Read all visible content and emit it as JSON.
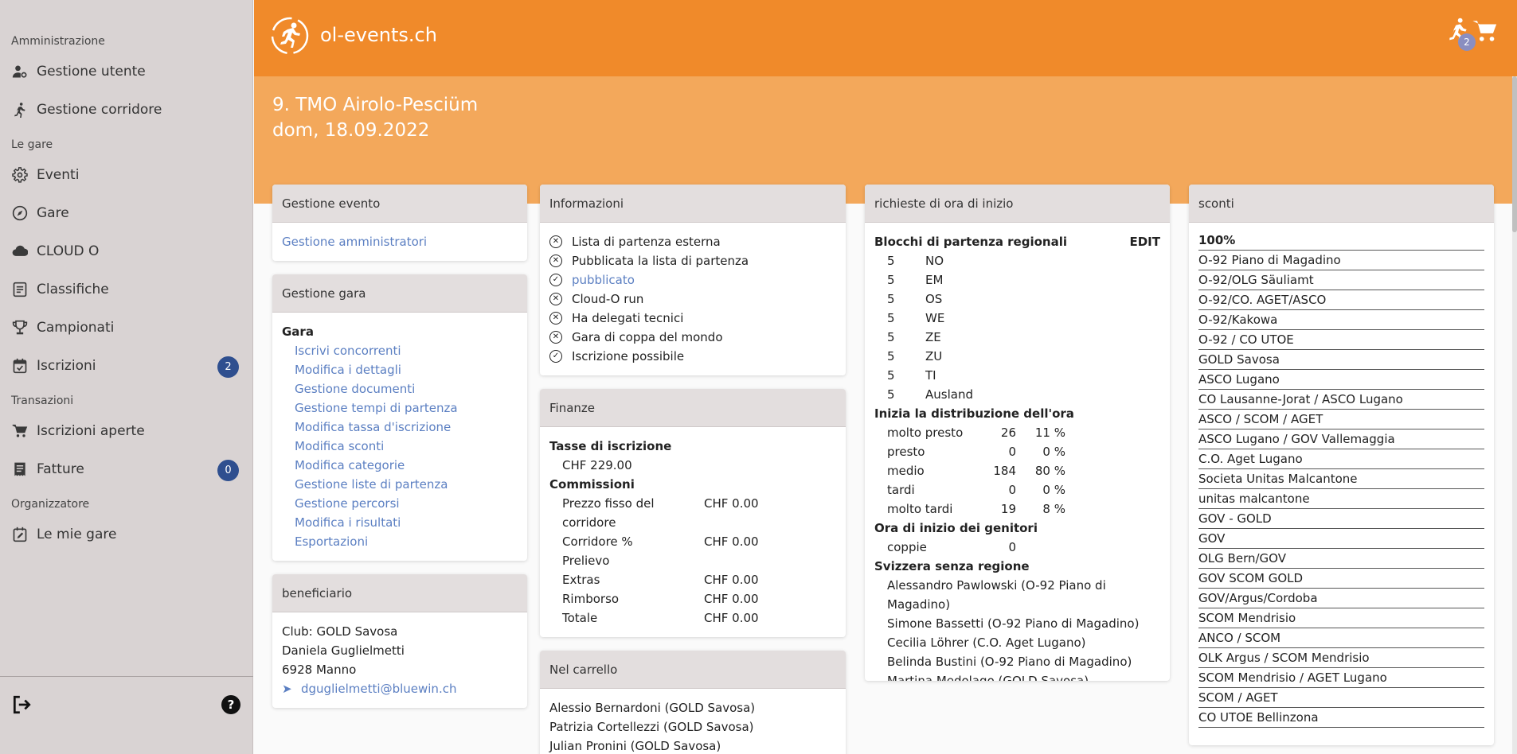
{
  "sidebar": {
    "sections": [
      {
        "title": "Amministrazione",
        "items": [
          {
            "label": "Gestione utente",
            "icon": "user-gear-icon"
          },
          {
            "label": "Gestione corridore",
            "icon": "runner-icon"
          }
        ]
      },
      {
        "title": "Le gare",
        "items": [
          {
            "label": "Eventi",
            "icon": "gear-icon"
          },
          {
            "label": "Gare",
            "icon": "compass-icon"
          },
          {
            "label": "CLOUD O",
            "icon": "cloud-icon"
          },
          {
            "label": "Classifiche",
            "icon": "list-icon"
          },
          {
            "label": "Campionati",
            "icon": "trophy-icon"
          },
          {
            "label": "Iscrizioni",
            "icon": "calendar-check-icon",
            "badge": "2"
          }
        ]
      },
      {
        "title": "Transazioni",
        "items": [
          {
            "label": "Iscrizioni aperte",
            "icon": "cart-icon"
          },
          {
            "label": "Fatture",
            "icon": "receipt-icon",
            "badge": "0"
          }
        ]
      },
      {
        "title": "Organizzatore",
        "items": [
          {
            "label": "Le mie gare",
            "icon": "calendar-edit-icon"
          }
        ]
      }
    ],
    "help_label": "?"
  },
  "header": {
    "brand": "ol-events.ch",
    "runner_badge": "2",
    "event_title": "9. TMO Airolo-Pesciüm",
    "event_date": "dom, 18.09.2022"
  },
  "gestione_evento": {
    "title": "Gestione evento",
    "link": "Gestione amministratori"
  },
  "gestione_gara": {
    "title": "Gestione gara",
    "group": "Gara",
    "links": [
      "Iscrivi concorrenti",
      "Modifica i dettagli",
      "Gestione documenti",
      "Gestione tempi di partenza",
      "Modifica tassa d'iscrizione",
      "Modifica sconti",
      "Modifica categorie",
      "Gestione liste di partenza",
      "Gestione percorsi",
      "Modifica i risultati",
      "Esportazioni"
    ]
  },
  "beneficiario": {
    "title": "beneficiario",
    "club": "Club: GOLD Savosa",
    "name": "Daniela Guglielmetti",
    "city": "6928 Manno",
    "email": "dguglielmetti@bluewin.ch"
  },
  "informazioni": {
    "title": "Informazioni",
    "items": [
      {
        "label": "Lista di partenza esterna",
        "state": "no",
        "link": false
      },
      {
        "label": "Pubblicata la lista di partenza",
        "state": "no",
        "link": false
      },
      {
        "label": "pubblicato",
        "state": "yes",
        "link": true
      },
      {
        "label": "Cloud-O run",
        "state": "no",
        "link": false
      },
      {
        "label": "Ha delegati tecnici",
        "state": "no",
        "link": false
      },
      {
        "label": "Gara di coppa del mondo",
        "state": "no",
        "link": false
      },
      {
        "label": "Iscrizione possibile",
        "state": "yes",
        "link": false
      }
    ]
  },
  "finanze": {
    "title": "Finanze",
    "tasse_label": "Tasse di iscrizione",
    "tasse_value": "CHF 229.00",
    "commissioni_label": "Commissioni",
    "rows": [
      {
        "label": "Prezzo fisso del",
        "label2": "corridore",
        "value": "CHF 0.00"
      },
      {
        "label": "Corridore %",
        "label2": "Prelievo",
        "value": "CHF 0.00"
      },
      {
        "label": "Extras",
        "label2": "",
        "value": "CHF 0.00"
      },
      {
        "label": "Rimborso",
        "label2": "",
        "value": "CHF 0.00"
      },
      {
        "label": "Totale",
        "label2": "",
        "value": "CHF 0.00"
      }
    ]
  },
  "carrello": {
    "title": "Nel carrello",
    "items": [
      "Alessio Bernardoni (GOLD Savosa)",
      "Patrizia Cortellezzi (GOLD Savosa)",
      "Julian Pronini (GOLD Savosa)"
    ]
  },
  "richieste": {
    "title": "richieste di ora di inizio",
    "blocchi_label": "Blocchi di partenza regionali",
    "edit_label": "EDIT",
    "blocchi": [
      {
        "n": "5",
        "code": "NO"
      },
      {
        "n": "5",
        "code": "EM"
      },
      {
        "n": "5",
        "code": "OS"
      },
      {
        "n": "5",
        "code": "WE"
      },
      {
        "n": "5",
        "code": "ZE"
      },
      {
        "n": "5",
        "code": "ZU"
      },
      {
        "n": "5",
        "code": "TI"
      },
      {
        "n": "5",
        "code": "Ausland"
      }
    ],
    "distribuzione_label": "Inizia la distribuzione dell'ora",
    "distribuzione": [
      {
        "label": "molto presto",
        "count": "26",
        "pct": "11 %"
      },
      {
        "label": "presto",
        "count": "0",
        "pct": "0 %"
      },
      {
        "label": "medio",
        "count": "184",
        "pct": "80 %"
      },
      {
        "label": "tardi",
        "count": "0",
        "pct": "0 %"
      },
      {
        "label": "molto tardi",
        "count": "19",
        "pct": "8 %"
      }
    ],
    "genitori_label": "Ora di inizio dei genitori",
    "coppie_label": "coppie",
    "coppie_value": "0",
    "svizzera_label": "Svizzera senza regione",
    "svizzera": [
      "Alessandro Pawlowski (O-92 Piano di Magadino)",
      "Simone Bassetti (O-92 Piano di Magadino)",
      "Cecilia Löhrer (C.O. Aget Lugano)",
      "Belinda Bustini (O-92 Piano di Magadino)",
      "Martina Medolago (GOLD Savosa)"
    ]
  },
  "sconti": {
    "title": "sconti",
    "header": "100%",
    "items": [
      "O-92 Piano di Magadino",
      "O-92/OLG Säuliamt",
      "O-92/CO. AGET/ASCO",
      "O-92/Kakowa",
      "O-92 / CO UTOE",
      "GOLD Savosa",
      "ASCO Lugano",
      "CO Lausanne-Jorat / ASCO Lugano",
      "ASCO / SCOM / AGET",
      "ASCO Lugano / GOV Vallemaggia",
      "C.O. Aget Lugano",
      "Societa Unitas Malcantone",
      "unitas malcantone",
      "GOV - GOLD",
      "GOV",
      "OLG Bern/GOV",
      "GOV SCOM GOLD",
      "GOV/Argus/Cordoba",
      "SCOM Mendrisio",
      "ANCO / SCOM",
      "OLK Argus / SCOM Mendrisio",
      "SCOM Mendrisio / AGET Lugano",
      "SCOM / AGET",
      "CO UTOE Bellinzona"
    ]
  }
}
